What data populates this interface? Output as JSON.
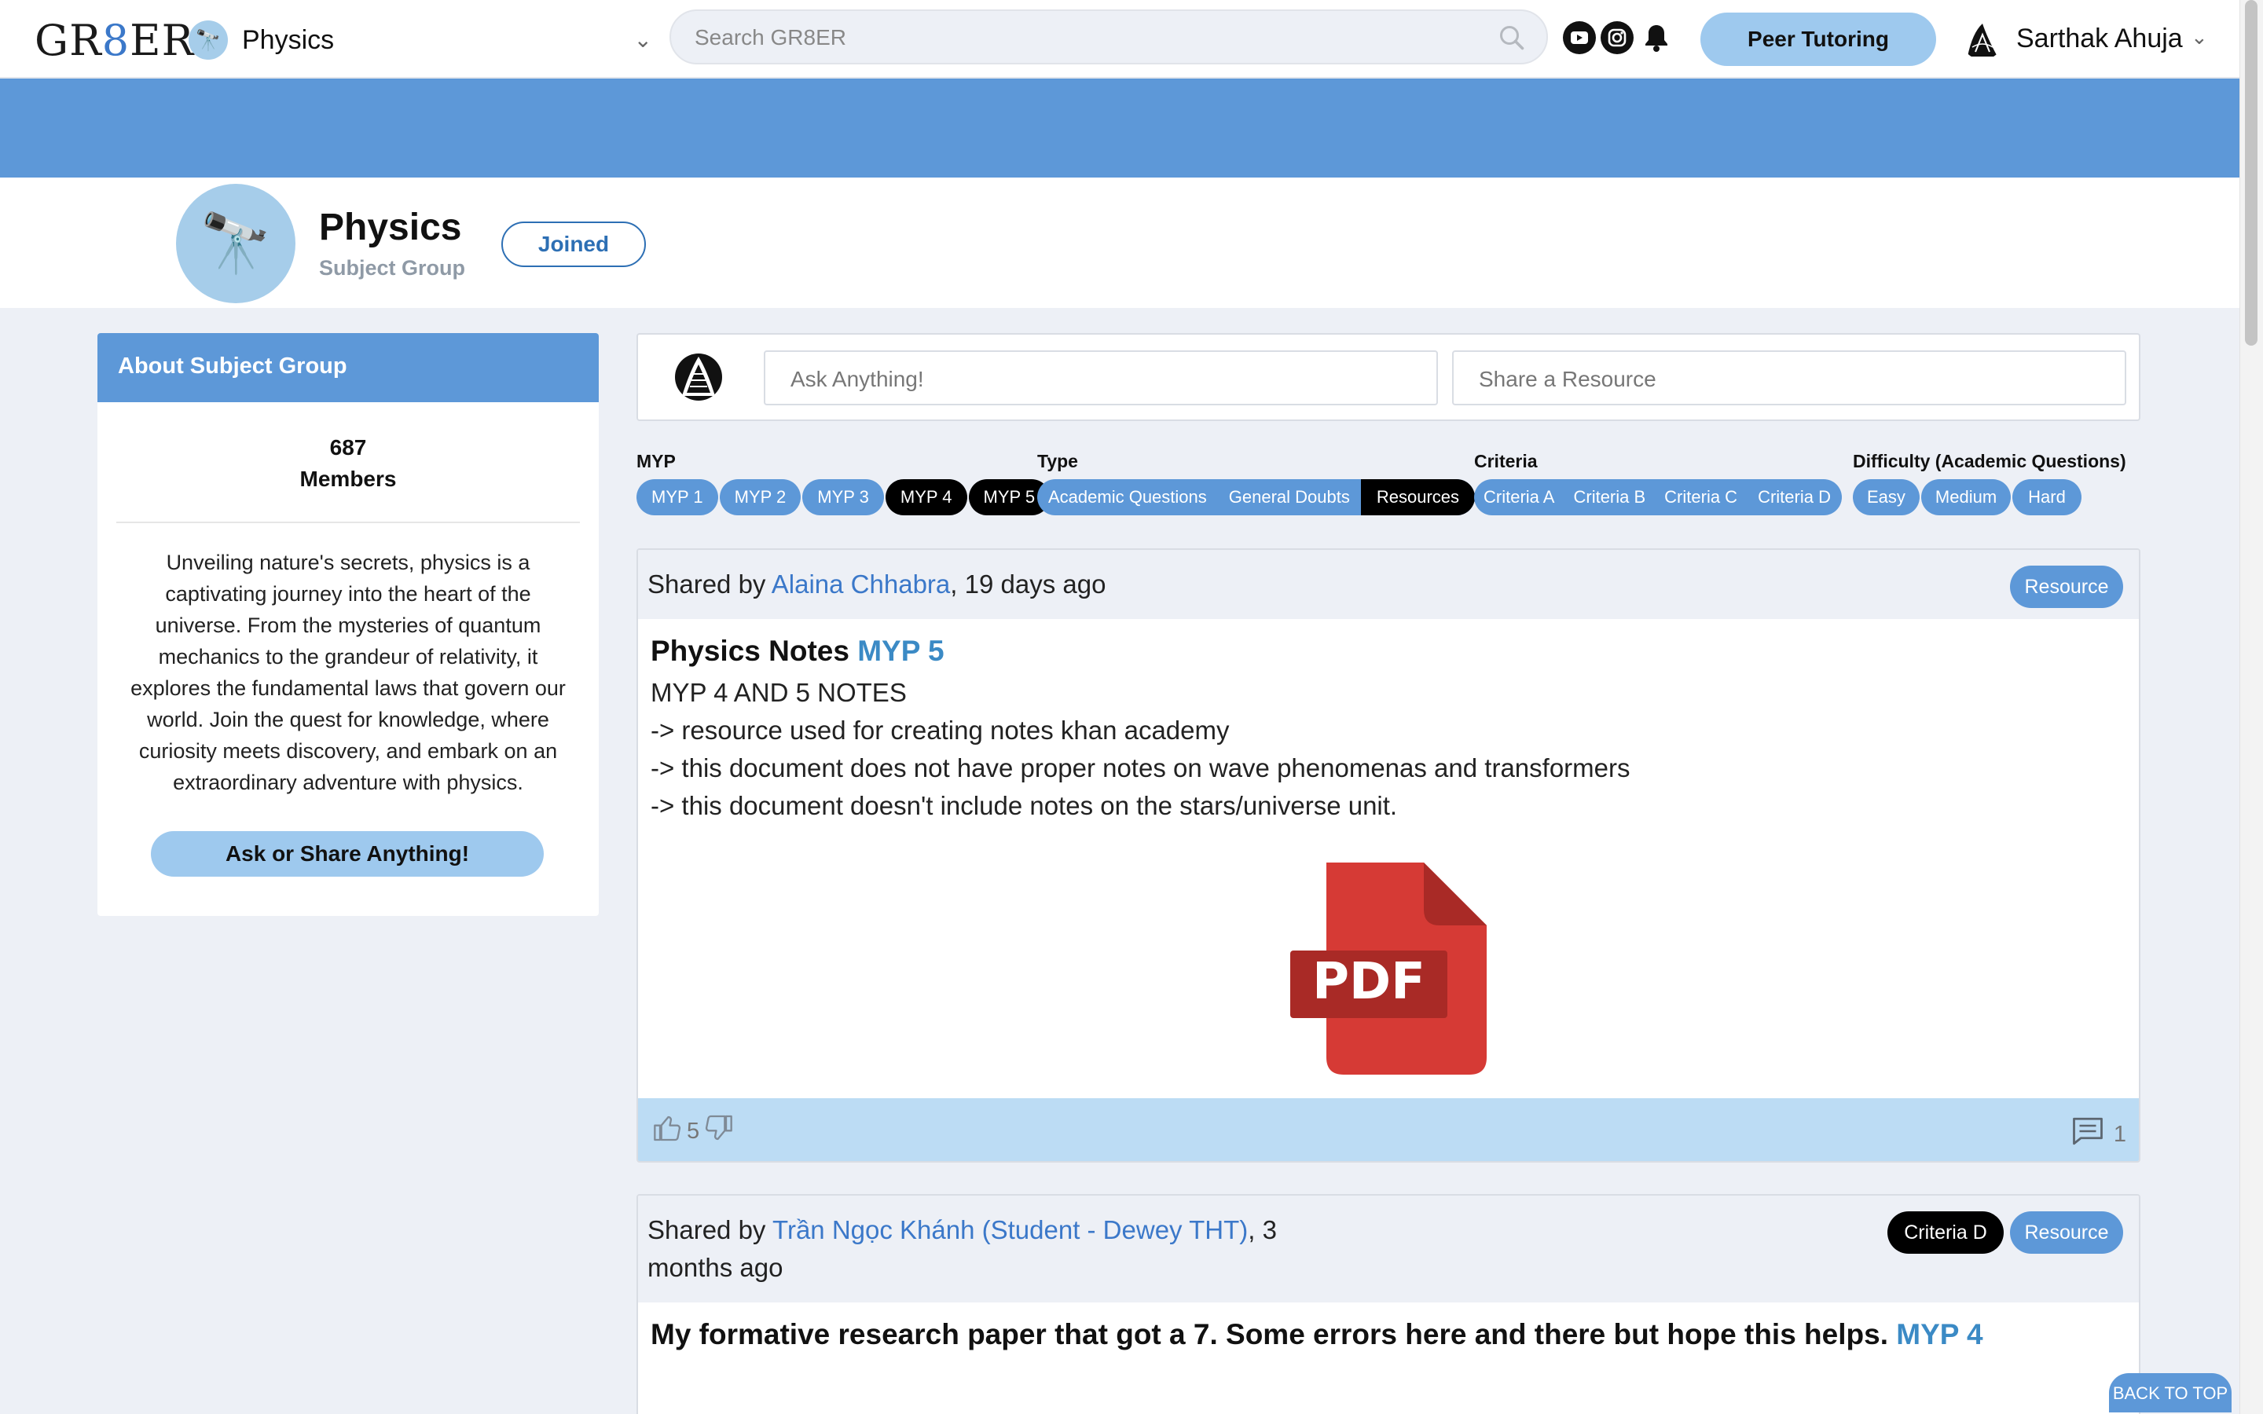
{
  "nav": {
    "logo": {
      "prefix": "GR",
      "eight": "8",
      "suffix": "ER"
    },
    "group_name": "Physics",
    "search_placeholder": "Search GR8ER",
    "peer_tutoring_label": "Peer Tutoring",
    "user_name": "Sarthak Ahuja"
  },
  "group": {
    "title": "Physics",
    "subtitle": "Subject Group",
    "joined_label": "Joined"
  },
  "about": {
    "heading": "About Subject Group",
    "members_count": "687",
    "members_label": "Members",
    "description": "Unveiling nature's secrets, physics is a captivating journey into the heart of the universe. From the mysteries of quantum mechanics to the grandeur of relativity, it explores the fundamental laws that govern our world. Join the quest for knowledge, where curiosity meets discovery, and embark on an extraordinary adventure with physics.",
    "cta_label": "Ask or Share Anything!"
  },
  "composer": {
    "ask_placeholder": "Ask Anything!",
    "share_placeholder": "Share a Resource"
  },
  "filters": {
    "myp": {
      "label": "MYP",
      "options": [
        "MYP 1",
        "MYP 2",
        "MYP 3",
        "MYP 4",
        "MYP 5"
      ],
      "active": [
        "MYP 4",
        "MYP 5"
      ]
    },
    "type": {
      "label": "Type",
      "options": [
        "Academic Questions",
        "General Doubts",
        "Resources"
      ],
      "active": [
        "Resources"
      ]
    },
    "criteria": {
      "label": "Criteria",
      "options": [
        "Criteria A",
        "Criteria B",
        "Criteria C",
        "Criteria D"
      ],
      "active": []
    },
    "difficulty": {
      "label": "Difficulty (Academic Questions)",
      "options": [
        "Easy",
        "Medium",
        "Hard"
      ],
      "active": []
    }
  },
  "posts": [
    {
      "shared_by_prefix": "Shared by ",
      "author": "Alaina Chhabra",
      "time": ", 19 days ago",
      "tags": [
        "Resource"
      ],
      "title": "Physics Notes",
      "myp": "MYP 5",
      "body_lines": [
        "MYP 4 AND 5 NOTES",
        "-> resource used for creating notes khan academy",
        "-> this document does not have proper notes on wave phenomenas and transformers",
        "-> this document doesn't include notes on the stars/universe unit."
      ],
      "attachment_label": "PDF",
      "likes": "5",
      "comments": "1"
    },
    {
      "shared_by_prefix": "Shared by ",
      "author": "Trần Ngọc Khánh (Student - Dewey THT)",
      "time": ", 3",
      "time_line2": "months ago",
      "tags": [
        "Criteria D",
        "Resource"
      ],
      "title": "My formative research paper that got a 7. Some errors here and there but hope this helps.",
      "myp": "MYP 4"
    }
  ],
  "back_to_top_label": "BACK TO TOP",
  "colors": {
    "brand_blue": "#5d98d8",
    "light_blue": "#9ec9ee",
    "link_blue": "#3b78c9",
    "pdf_red": "#d63a35"
  },
  "icons": [
    "search-icon",
    "chevron-down-icon",
    "youtube-icon",
    "instagram-icon",
    "bell-icon",
    "thumbs-up-icon",
    "thumbs-down-icon",
    "comment-icon",
    "telescope-icon",
    "pdf-file-icon"
  ]
}
